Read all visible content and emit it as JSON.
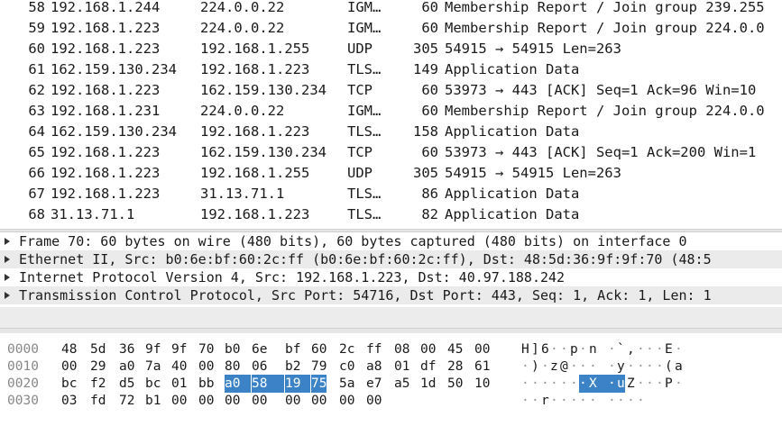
{
  "packets": [
    {
      "no": "58",
      "src": "192.168.1.244",
      "dst": "224.0.0.22",
      "proto": "IGM…",
      "len": "60",
      "info": "Membership Report / Join group 239.255"
    },
    {
      "no": "59",
      "src": "192.168.1.223",
      "dst": "224.0.0.22",
      "proto": "IGM…",
      "len": "60",
      "info": "Membership Report / Join group 224.0.0"
    },
    {
      "no": "60",
      "src": "192.168.1.223",
      "dst": "192.168.1.255",
      "proto": "UDP",
      "len": "305",
      "info": "54915 → 54915 Len=263"
    },
    {
      "no": "61",
      "src": "162.159.130.234",
      "dst": "192.168.1.223",
      "proto": "TLS…",
      "len": "149",
      "info": "Application Data"
    },
    {
      "no": "62",
      "src": "192.168.1.223",
      "dst": "162.159.130.234",
      "proto": "TCP",
      "len": "60",
      "info": "53973 → 443 [ACK] Seq=1 Ack=96 Win=10"
    },
    {
      "no": "63",
      "src": "192.168.1.231",
      "dst": "224.0.0.22",
      "proto": "IGM…",
      "len": "60",
      "info": "Membership Report / Join group 224.0.0"
    },
    {
      "no": "64",
      "src": "162.159.130.234",
      "dst": "192.168.1.223",
      "proto": "TLS…",
      "len": "158",
      "info": "Application Data"
    },
    {
      "no": "65",
      "src": "192.168.1.223",
      "dst": "162.159.130.234",
      "proto": "TCP",
      "len": "60",
      "info": "53973 → 443 [ACK] Seq=1 Ack=200 Win=1"
    },
    {
      "no": "66",
      "src": "192.168.1.223",
      "dst": "192.168.1.255",
      "proto": "UDP",
      "len": "305",
      "info": "54915 → 54915 Len=263"
    },
    {
      "no": "67",
      "src": "192.168.1.223",
      "dst": "31.13.71.1",
      "proto": "TLS…",
      "len": "86",
      "info": "Application Data"
    },
    {
      "no": "68",
      "src": "31.13.71.1",
      "dst": "192.168.1.223",
      "proto": "TLS…",
      "len": "82",
      "info": "Application Data"
    }
  ],
  "details": [
    "Frame 70: 60 bytes on wire (480 bits), 60 bytes captured (480 bits) on interface 0",
    "Ethernet II, Src: b0:6e:bf:60:2c:ff (b0:6e:bf:60:2c:ff), Dst: 48:5d:36:9f:9f:70 (48:5",
    "Internet Protocol Version 4, Src: 192.168.1.223, Dst: 40.97.188.242",
    "Transmission Control Protocol, Src Port: 54716, Dst Port: 443, Seq: 1, Ack: 1, Len: 1"
  ],
  "bytes": [
    {
      "offset": "0000",
      "hex": [
        "48",
        "5d",
        "36",
        "9f",
        "9f",
        "70",
        "b0",
        "6e",
        "bf",
        "60",
        "2c",
        "ff",
        "08",
        "00",
        "45",
        "00"
      ],
      "ascii": [
        "H",
        "]",
        "6",
        "·",
        "·",
        "p",
        "·",
        "n",
        "·",
        "`",
        ",",
        "·",
        "·",
        "·",
        "E",
        "·"
      ]
    },
    {
      "offset": "0010",
      "hex": [
        "00",
        "29",
        "a0",
        "7a",
        "40",
        "00",
        "80",
        "06",
        "b2",
        "79",
        "c0",
        "a8",
        "01",
        "df",
        "28",
        "61"
      ],
      "ascii": [
        "·",
        ")",
        "·",
        "z",
        "@",
        "·",
        "·",
        "·",
        "·",
        "y",
        "·",
        "·",
        "·",
        "·",
        "(",
        "a"
      ]
    },
    {
      "offset": "0020",
      "hex": [
        "bc",
        "f2",
        "d5",
        "bc",
        "01",
        "bb",
        "a0",
        "58",
        "19",
        "75",
        "5a",
        "e7",
        "a5",
        "1d",
        "50",
        "10"
      ],
      "ascii": [
        "·",
        "·",
        "·",
        "·",
        "·",
        "·",
        "·",
        "X",
        "·",
        "u",
        "Z",
        "·",
        "·",
        "·",
        "P",
        "·"
      ]
    },
    {
      "offset": "0030",
      "hex": [
        "03",
        "fd",
        "72",
        "b1",
        "00",
        "00",
        "00",
        "00",
        "00",
        "00",
        "00",
        "00"
      ],
      "ascii": [
        "·",
        "·",
        "r",
        "·",
        "·",
        "·",
        "·",
        "·",
        "·",
        "·",
        "·",
        "·"
      ]
    }
  ],
  "highlight": {
    "row": 2,
    "from": 6,
    "to": 9
  },
  "colors": {
    "highlight": "#3b83c6",
    "shaded": "#ebebeb",
    "offset_gray": "#888888"
  }
}
